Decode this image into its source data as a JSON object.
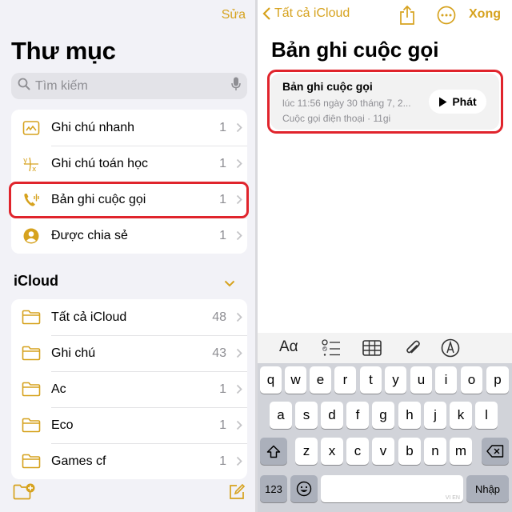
{
  "left": {
    "edit_label": "Sửa",
    "title": "Thư mục",
    "search_placeholder": "Tìm kiếm",
    "pinned": [
      {
        "label": "Ghi chú nhanh",
        "count": "1",
        "icon": "quick-note-icon"
      },
      {
        "label": "Ghi chú toán học",
        "count": "1",
        "icon": "math-notes-icon"
      },
      {
        "label": "Bản ghi cuộc gọi",
        "count": "1",
        "icon": "call-recording-icon"
      },
      {
        "label": "Được chia sẻ",
        "count": "1",
        "icon": "shared-person-icon"
      }
    ],
    "section_title": "iCloud",
    "folders": [
      {
        "label": "Tất cả iCloud",
        "count": "48"
      },
      {
        "label": "Ghi chú",
        "count": "43"
      },
      {
        "label": "Ac",
        "count": "1"
      },
      {
        "label": "Eco",
        "count": "1"
      },
      {
        "label": "Games cf",
        "count": "1"
      }
    ]
  },
  "right": {
    "back_label": "Tất cả iCloud",
    "done_label": "Xong",
    "note_title": "Bản ghi cuộc gọi",
    "recording": {
      "title": "Bản ghi cuộc gọi",
      "date": "lúc 11:56 ngày 30 tháng 7, 2...",
      "meta": "Cuộc gọi điện thoại · 11gi",
      "play_label": "Phát"
    },
    "toolbar": {
      "format_label": "Aα"
    },
    "keyboard": {
      "row1": [
        "q",
        "w",
        "e",
        "r",
        "t",
        "y",
        "u",
        "i",
        "o",
        "p"
      ],
      "row2": [
        "a",
        "s",
        "d",
        "f",
        "g",
        "h",
        "j",
        "k",
        "l"
      ],
      "row3": [
        "z",
        "x",
        "c",
        "v",
        "b",
        "n",
        "m"
      ],
      "numbers_label": "123",
      "return_label": "Nhập",
      "space_watermark": "VI EN"
    }
  },
  "colors": {
    "accent": "#d6a21e",
    "highlight": "#e0242c",
    "keyboard_bg": "#d1d3d9"
  }
}
